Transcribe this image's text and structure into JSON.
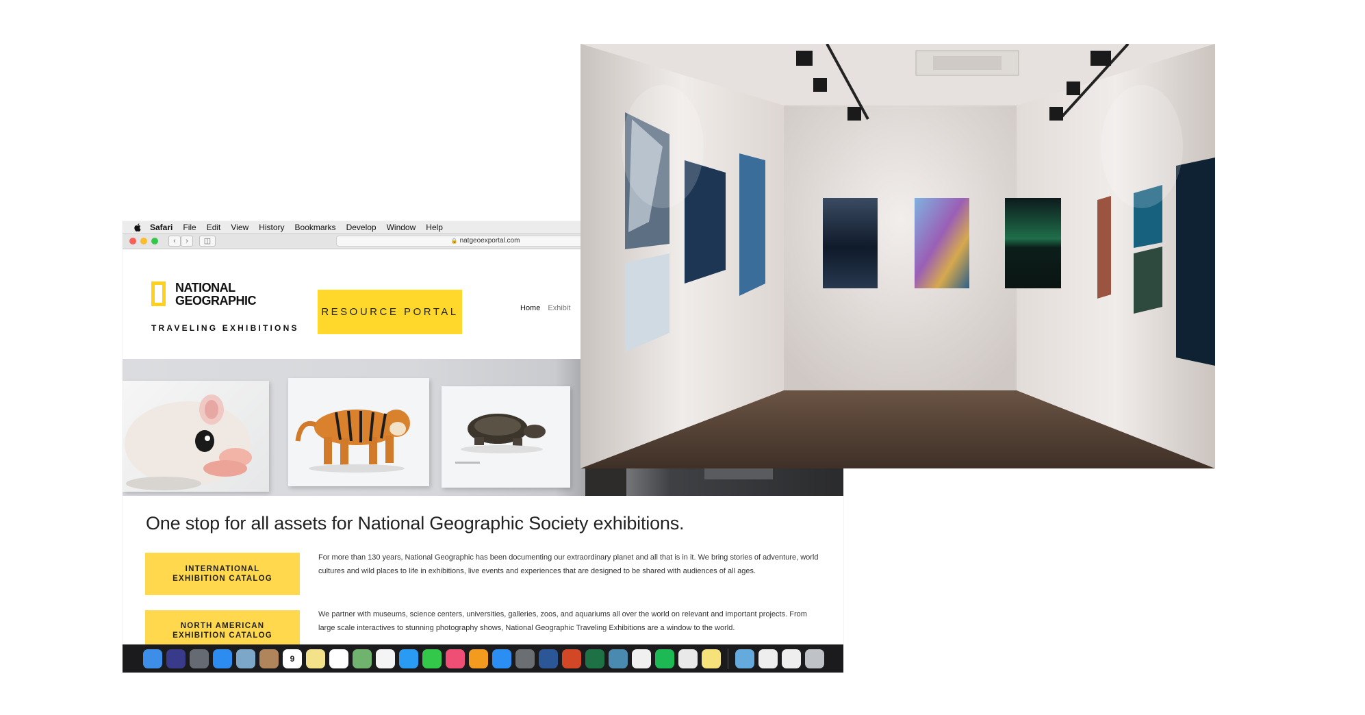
{
  "menubar": {
    "app_name": "Safari",
    "items": [
      "File",
      "Edit",
      "View",
      "History",
      "Bookmarks",
      "Develop",
      "Window",
      "Help"
    ]
  },
  "toolbar": {
    "url": "natgeoexportal.com"
  },
  "site": {
    "logo_line1": "NATIONAL",
    "logo_line2": "GEOGRAPHIC",
    "tagline": "TRAVELING EXHIBITIONS",
    "resource_button": "RESOURCE PORTAL",
    "nav": {
      "home": "Home",
      "exhibitions_partial": "Exhibit"
    },
    "headline": "One stop for all assets for National Geographic Society exhibitions.",
    "catalog_buttons": [
      {
        "line1": "INTERNATIONAL",
        "line2": "EXHIBITION CATALOG"
      },
      {
        "line1": "NORTH AMERICAN",
        "line2": "EXHIBITION CATALOG"
      }
    ],
    "paragraph1": "For more than 130 years, National Geographic has been documenting our extraordinary planet and all that is in it. We bring stories of adventure, world cultures and wild places to life in exhibitions, live events and experiences that are designed to be shared with audiences of all ages.",
    "paragraph2": "We partner with museums, science centers, universities, galleries, zoos, and aquariums all over the world on relevant and important projects. From large scale interactives to stunning photography shows, National Geographic Traveling Exhibitions are a window to the world."
  },
  "dock": {
    "calendar_day": "9",
    "icons": [
      "finder-icon",
      "siri-icon",
      "launchpad-icon",
      "safari-icon",
      "preview-icon",
      "contacts-icon",
      "calendar-icon",
      "notes-icon",
      "reminders-icon",
      "maps-icon",
      "photos-icon",
      "messages-icon",
      "facetime-icon",
      "itunes-icon",
      "ibooks-icon",
      "app-store-icon",
      "system-preferences-icon",
      "word-icon",
      "powerpoint-icon",
      "excel-icon",
      "network-icon",
      "slack-icon",
      "spotify-icon",
      "chrome-icon",
      "stickies-icon",
      "folder-icon",
      "window-icon",
      "window-icon-2",
      "trash-icon"
    ],
    "colors": [
      "#3c8ee8",
      "#3a3a8a",
      "#666b73",
      "#2d8cf0",
      "#7da7c9",
      "#b0855b",
      "#ffffff",
      "#f3e28a",
      "#ffffff",
      "#6fb36e",
      "#f4f4f4",
      "#2a9bf3",
      "#34c84a",
      "#ef4e75",
      "#f29b1f",
      "#2a8ef2",
      "#6b6f74",
      "#2b5797",
      "#d24726",
      "#1e7145",
      "#4a8ab0",
      "#f0f0f0",
      "#1db954",
      "#e9e9e9",
      "#f6e27a",
      "#64aadc",
      "#eeeeee",
      "#eeeeee",
      "#bfc3c7"
    ]
  }
}
